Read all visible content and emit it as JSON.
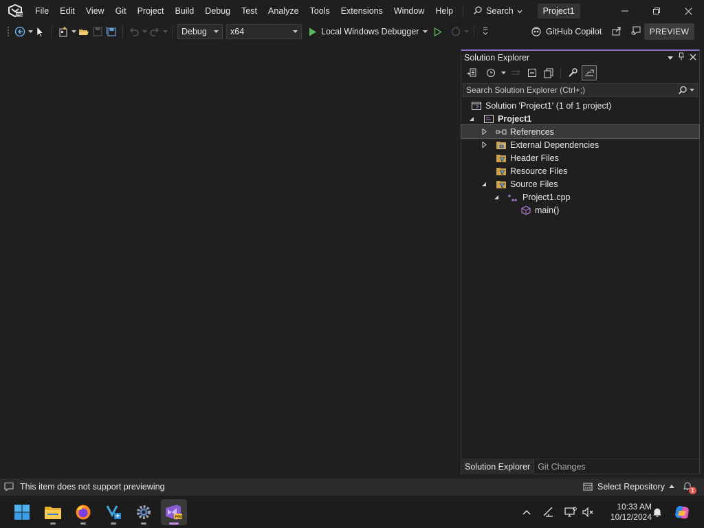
{
  "titlebar": {
    "menu": [
      "File",
      "Edit",
      "View",
      "Git",
      "Project",
      "Build",
      "Debug",
      "Test",
      "Analyze",
      "Tools",
      "Extensions",
      "Window",
      "Help"
    ],
    "search_label": "Search",
    "project_title": "Project1"
  },
  "toolbar": {
    "config": "Debug",
    "platform": "x64",
    "debugger_label": "Local Windows Debugger",
    "copilot_label": "GitHub Copilot",
    "preview_label": "PREVIEW"
  },
  "solution_explorer": {
    "title": "Solution Explorer",
    "search_placeholder": "Search Solution Explorer (Ctrl+;)",
    "tree": {
      "solution": "Solution 'Project1' (1 of 1 project)",
      "project": "Project1",
      "references": "References",
      "external_deps": "External Dependencies",
      "header_files": "Header Files",
      "resource_files": "Resource Files",
      "source_files": "Source Files",
      "cpp_file": "Project1.cpp",
      "main_fn": "main()"
    },
    "tabs": [
      "Solution Explorer",
      "Git Changes"
    ]
  },
  "statusbar": {
    "message": "This item does not support previewing",
    "repo_label": "Select Repository",
    "notification_count": "1"
  },
  "taskbar": {
    "apps": [
      "start-icon",
      "file-explorer-icon",
      "firefox-icon",
      "vs-installer-icon",
      "settings-icon",
      "visual-studio-preview-icon"
    ],
    "time": "10:33 AM",
    "date": "10/12/2024"
  },
  "colors": {
    "accent": "#8a6fd1",
    "background": "#1f1f1f",
    "statusbar": "#2b2b2b"
  }
}
